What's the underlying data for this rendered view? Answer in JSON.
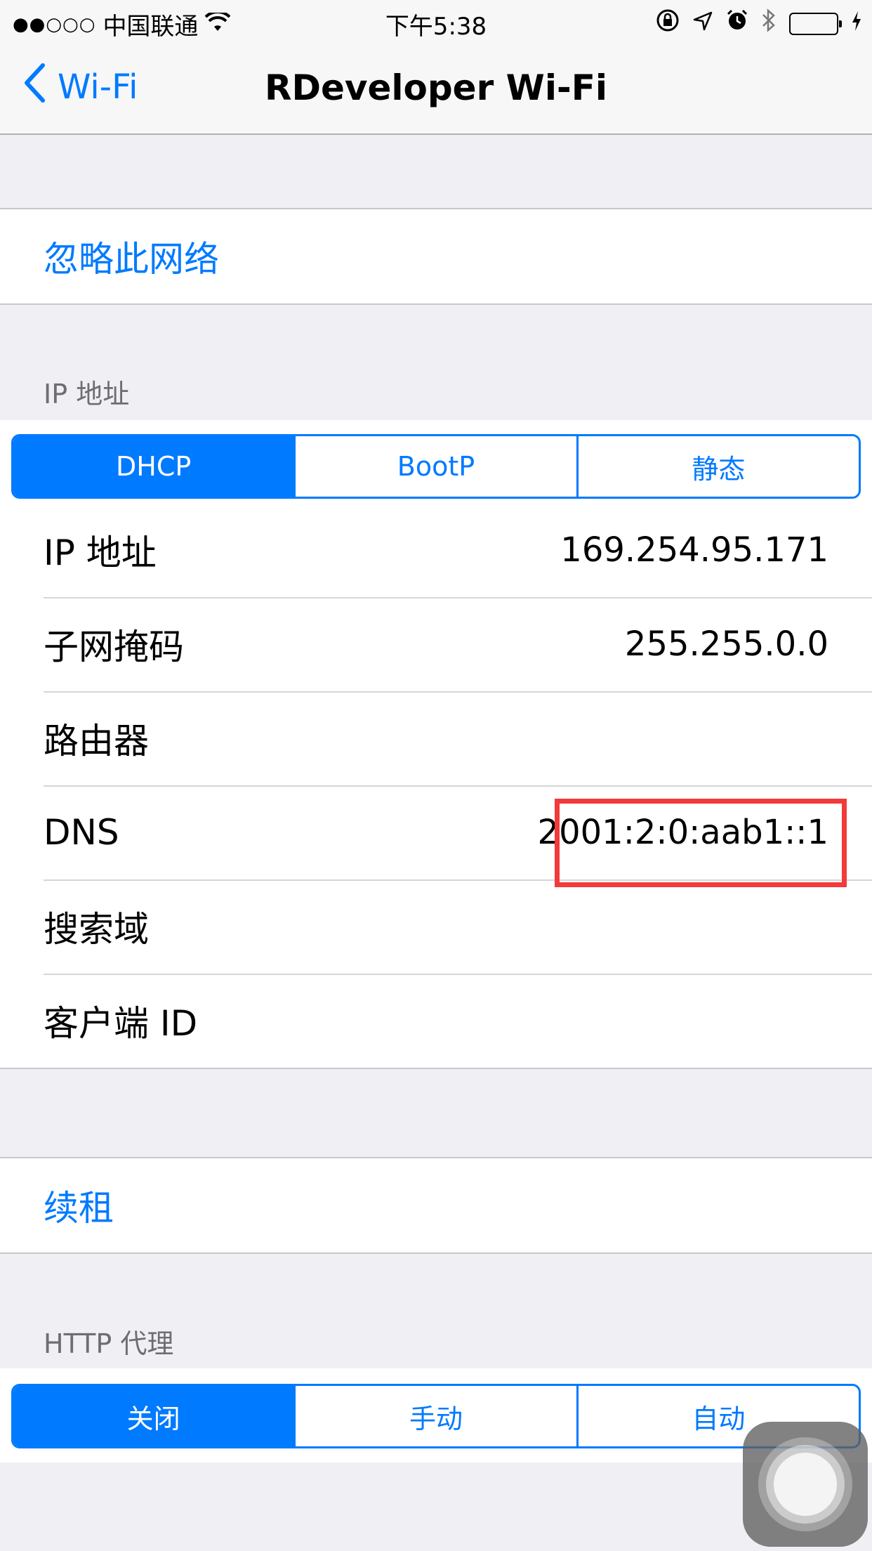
{
  "status_bar": {
    "signal": "●●○○○",
    "carrier": "中国联通",
    "time": "下午5:38"
  },
  "nav": {
    "back_label": "Wi-Fi",
    "title": "RDeveloper Wi-Fi"
  },
  "forget_network": "忽略此网络",
  "ip_section": {
    "header": "IP 地址",
    "segments": [
      "DHCP",
      "BootP",
      "静态"
    ],
    "selected": "DHCP",
    "rows": [
      {
        "label": "IP 地址",
        "value": "169.254.95.171"
      },
      {
        "label": "子网掩码",
        "value": "255.255.0.0"
      },
      {
        "label": "路由器",
        "value": ""
      },
      {
        "label": "DNS",
        "value": "2001:2:0:aab1::1"
      },
      {
        "label": "搜索域",
        "value": ""
      },
      {
        "label": "客户端 ID",
        "value": ""
      }
    ]
  },
  "renew_lease": "续租",
  "proxy_section": {
    "header": "HTTP 代理",
    "segments": [
      "关闭",
      "手动",
      "自动"
    ],
    "selected": "关闭"
  },
  "colors": {
    "accent": "#007aff",
    "highlight": "#f23a3a",
    "battery": "#4cd964",
    "background": "#efeff4"
  }
}
